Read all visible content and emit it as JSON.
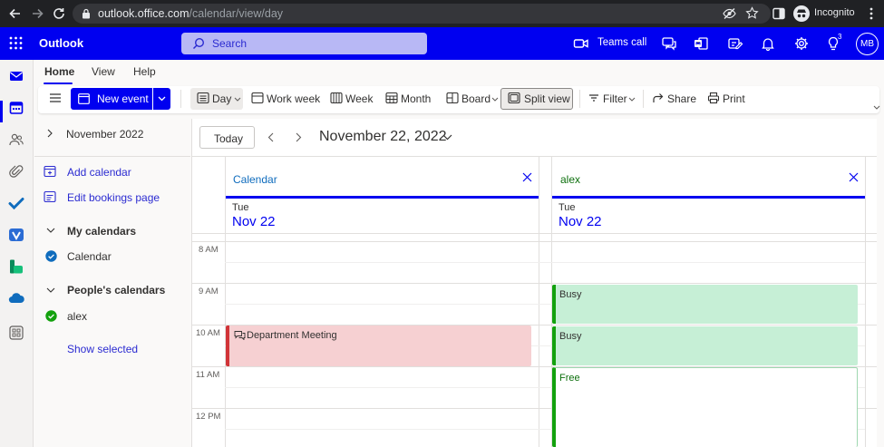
{
  "browser": {
    "url_host": "outlook.office.com",
    "url_path": "/calendar/view/day",
    "profile_label": "Incognito"
  },
  "header": {
    "app_title": "Outlook",
    "search_placeholder": "Search",
    "teams_call_label": "Teams call",
    "tips_badge": "3",
    "avatar_initials": "MB"
  },
  "tabs": [
    {
      "label": "Home"
    },
    {
      "label": "View"
    },
    {
      "label": "Help"
    }
  ],
  "ribbon": {
    "new_event": "New event",
    "day": "Day",
    "work_week": "Work week",
    "week": "Week",
    "month": "Month",
    "board": "Board",
    "split_view": "Split view",
    "filter": "Filter",
    "share": "Share",
    "print": "Print"
  },
  "left_pane": {
    "mini_month": "November 2022",
    "add_calendar": "Add calendar",
    "edit_bookings": "Edit bookings page",
    "my_calendars_heading": "My calendars",
    "my_calendars": [
      {
        "label": "Calendar",
        "color": "#0f6cbd"
      }
    ],
    "people_calendars_heading": "People's calendars",
    "people_calendars": [
      {
        "label": "alex",
        "color": "#13a10e"
      }
    ],
    "show_selected": "Show selected"
  },
  "calendar": {
    "today_button": "Today",
    "date_title": "November 22, 2022",
    "time_labels": [
      "8 AM",
      "9 AM",
      "10 AM",
      "11 AM",
      "12 PM"
    ],
    "columns": [
      {
        "name": "Calendar",
        "name_color": "#0f6cbd",
        "day_of_week": "Tue",
        "date": "Nov 22"
      },
      {
        "name": "alex",
        "name_color": "#0e700e",
        "day_of_week": "Tue",
        "date": "Nov 22"
      }
    ],
    "events": {
      "department_meeting": {
        "title": "Department Meeting",
        "color": "#d13438",
        "bg": "#f6d0d2"
      },
      "busy_1": {
        "title": "Busy",
        "color": "#13a10e",
        "bg": "#c6efd6"
      },
      "busy_2": {
        "title": "Busy",
        "color": "#13a10e",
        "bg": "#c6efd6"
      },
      "free": {
        "title": "Free",
        "color": "#13a10e",
        "bg": "#ffffff"
      }
    }
  },
  "colors": {
    "brand": "#0000f0",
    "browser_chrome": "#202124"
  }
}
